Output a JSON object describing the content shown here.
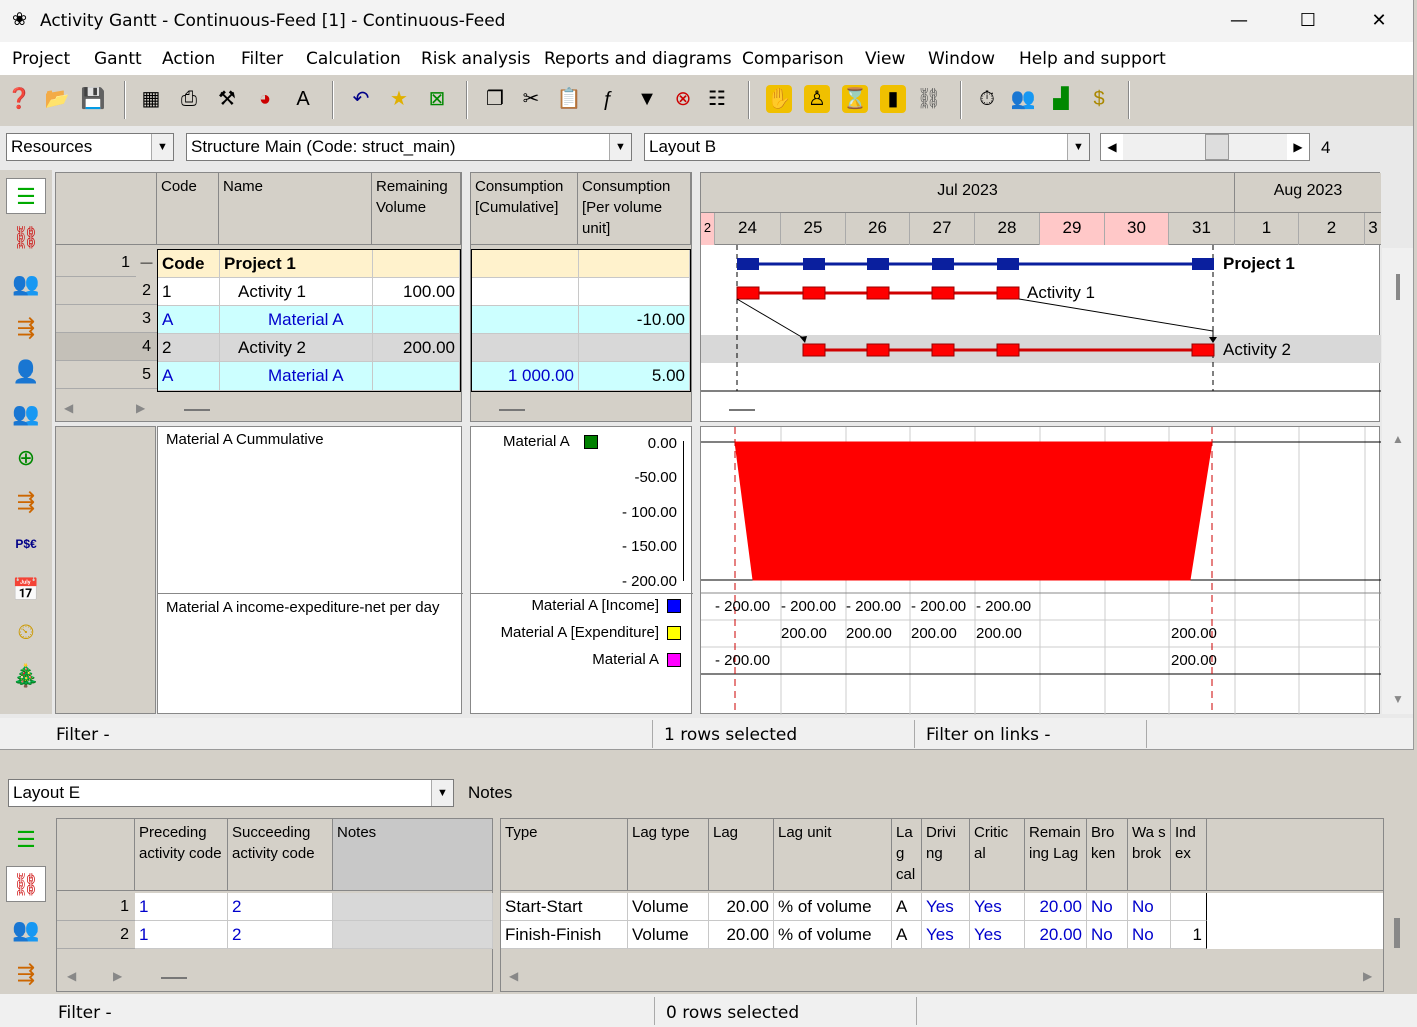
{
  "window": {
    "title": "Activity Gantt - Continuous-Feed [1] - Continuous-Feed",
    "minimize": "—",
    "maximize": "☐",
    "close": "✕"
  },
  "menu": [
    "Project",
    "Gantt",
    "Action",
    "Filter",
    "Calculation",
    "Risk analysis",
    "Reports and diagrams",
    "Comparison",
    "View",
    "Window",
    "Help and support"
  ],
  "combos": {
    "resources": "Resources",
    "structure": "Structure Main (Code: struct_main)",
    "layout": "Layout B",
    "zoom": "4"
  },
  "table_headers": [
    "Code",
    "Name",
    "Remaining Volume",
    "Consumption [Cumulative]",
    "Consumption [Per volume unit]"
  ],
  "rows": [
    {
      "n": "1",
      "toggle": "—",
      "code": "Code",
      "name": "Project 1",
      "vol": "",
      "cum": "",
      "per": ""
    },
    {
      "n": "2",
      "code": "1",
      "name": "Activity 1",
      "vol": "100.00",
      "cum": "",
      "per": ""
    },
    {
      "n": "3",
      "code": "A",
      "name": "Material A",
      "vol": "",
      "cum": "",
      "per": "-10.00"
    },
    {
      "n": "4",
      "code": "2",
      "name": "Activity 2",
      "vol": "200.00",
      "cum": "",
      "per": ""
    },
    {
      "n": "5",
      "code": "A",
      "name": "Material A",
      "vol": "",
      "cum": "1 000.00",
      "per": "5.00"
    }
  ],
  "timeline": {
    "month1": "Jul 2023",
    "month2": "Aug 2023",
    "days": [
      "2",
      "24",
      "25",
      "26",
      "27",
      "28",
      "29",
      "30",
      "31",
      "1",
      "2",
      "3"
    ]
  },
  "gantt_labels": {
    "project": "Project 1",
    "act1": "Activity 1",
    "act2": "Activity 2"
  },
  "histogram": {
    "title": "Material A Cummulative",
    "legend": "Material A",
    "yticks": [
      "0.00",
      "-50.00",
      "- 100.00",
      "- 150.00",
      "- 200.00"
    ],
    "values": [
      0,
      -200,
      -200,
      -200,
      -200,
      -200,
      -200,
      0
    ]
  },
  "netpanel": {
    "title": "Material A income-expediture-net per day",
    "legend": [
      "Material A [Income]",
      "Material A [Expenditure]",
      "Material A"
    ],
    "income": [
      "- 200.00",
      "- 200.00",
      "- 200.00",
      "- 200.00",
      "- 200.00"
    ],
    "expenditure": [
      "200.00",
      "200.00",
      "200.00",
      "200.00",
      "200.00"
    ],
    "net": [
      "- 200.00",
      "200.00"
    ]
  },
  "status1": {
    "filter": "Filter -",
    "sel": "1 rows selected",
    "links": "Filter on links -"
  },
  "lower": {
    "layout": "Layout E",
    "notes": "Notes",
    "headers": [
      "Preceding activity code",
      "Succeeding activity code",
      "Notes",
      "Type",
      "Lag type",
      "Lag",
      "Lag unit",
      "La g cal",
      "Drivi ng",
      "Critic al",
      "Remain ing Lag",
      "Bro ken",
      "Wa s brok",
      "Ind ex"
    ],
    "rows": [
      {
        "n": "1",
        "pre": "1",
        "suc": "2",
        "type": "Start-Start",
        "lagtype": "Volume",
        "lag": "20.00",
        "unit": "% of volume",
        "cal": "A",
        "drv": "Yes",
        "crit": "Yes",
        "rem": "20.00",
        "brk": "No",
        "was": "No",
        "idx": ""
      },
      {
        "n": "2",
        "pre": "1",
        "suc": "2",
        "type": "Finish-Finish",
        "lagtype": "Volume",
        "lag": "20.00",
        "unit": "% of volume",
        "cal": "A",
        "drv": "Yes",
        "crit": "Yes",
        "rem": "20.00",
        "brk": "No",
        "was": "No",
        "idx": "1"
      }
    ]
  },
  "status2": {
    "filter": "Filter -",
    "sel": "0 rows selected"
  },
  "colors": {
    "blue": "#0a1f9e",
    "red": "#ff0000",
    "weekend": "#ffc8c8",
    "project_row": "#fff2cc",
    "material_row": "#ccffff"
  }
}
